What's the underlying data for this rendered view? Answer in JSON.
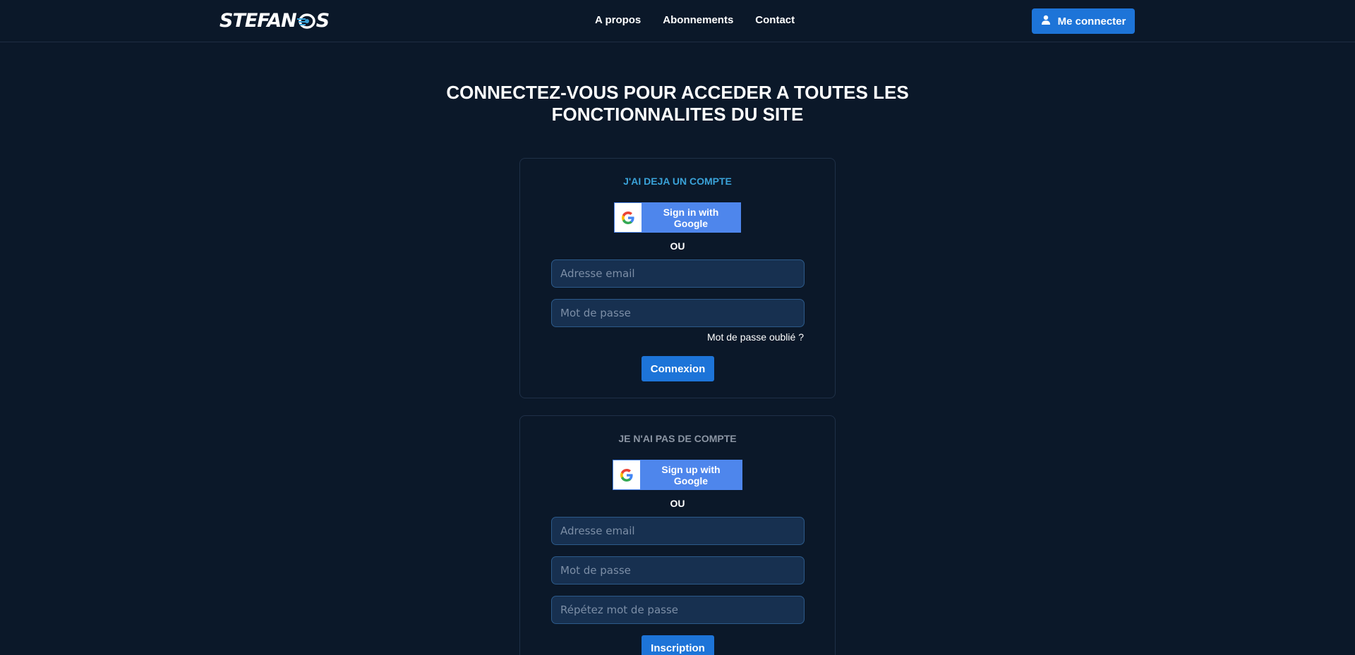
{
  "header": {
    "logo_text_left": "STEFAN",
    "logo_text_right": "S",
    "nav": [
      {
        "label": "A propos"
      },
      {
        "label": "Abonnements"
      },
      {
        "label": "Contact"
      }
    ],
    "login_button": "Me connecter"
  },
  "page": {
    "title_line1": "CONNECTEZ-VOUS POUR ACCEDER A TOUTES LES",
    "title_line2": "FONCTIONNALITES DU SITE"
  },
  "login": {
    "title": "J'AI DEJA UN COMPTE",
    "google_label": "Sign in with Google",
    "or_label": "OU",
    "email_placeholder": "Adresse email",
    "password_placeholder": "Mot de passe",
    "forgot_label": "Mot de passe oublié ?",
    "submit_label": "Connexion"
  },
  "signup": {
    "title": "JE N'AI PAS DE COMPTE",
    "google_label": "Sign up with Google",
    "or_label": "OU",
    "email_placeholder": "Adresse email",
    "password_placeholder": "Mot de passe",
    "repeat_password_placeholder": "Répétez mot de passe",
    "submit_label": "Inscription"
  },
  "colors": {
    "background": "#0b1829",
    "primary_button": "#1d74d8",
    "google_button": "#4e86ec",
    "login_title": "#3aa2d8",
    "signup_title": "#8b95a3",
    "input_bg": "#173050"
  },
  "icons": [
    "user-icon",
    "google-g-icon"
  ]
}
